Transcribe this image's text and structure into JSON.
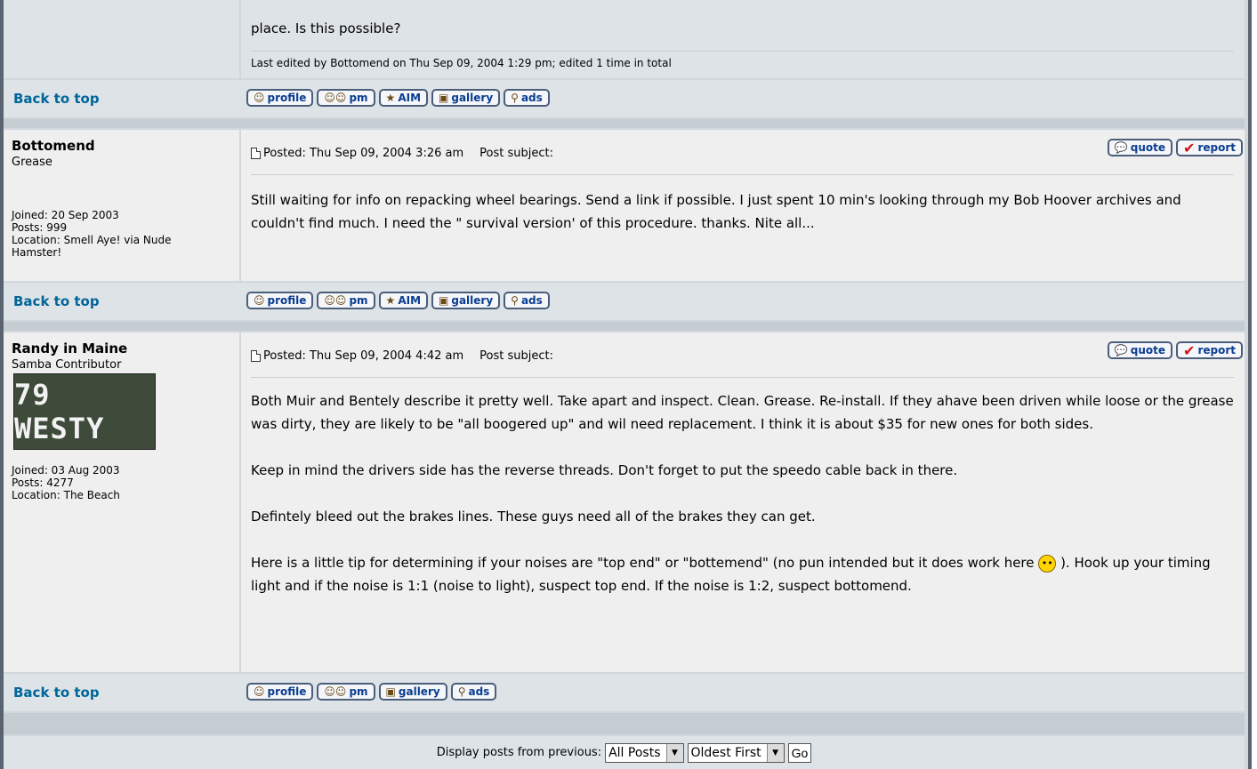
{
  "post0": {
    "body_tail": "place. Is this possible?",
    "edited": "Last edited by Bottomend on Thu Sep 09, 2004 1:29 pm; edited 1 time in total"
  },
  "back_to_top": "Back to top",
  "buttons": {
    "profile": "profile",
    "pm": "pm",
    "aim": "AIM",
    "gallery": "gallery",
    "ads": "ads",
    "quote": "quote",
    "report": "report"
  },
  "post1": {
    "username": "Bottomend",
    "rank": "Grease",
    "joined": "Joined: 20 Sep 2003",
    "posts": "Posts: 999",
    "location": "Location: Smell Aye! via Nude Hamster!",
    "posted": "Posted: Thu Sep 09, 2004 3:26 am",
    "subject": "Post subject:",
    "body": "Still waiting for info on repacking wheel bearings. Send a link if possible. I just spent 10 min's looking through my Bob Hoover archives and couldn't find much. I need the \" survival version' of this procedure. thanks. Nite all..."
  },
  "post2": {
    "username": "Randy in Maine",
    "rank": "Samba Contributor",
    "avatar_text": "79 WESTY",
    "joined": "Joined: 03 Aug 2003",
    "posts": "Posts: 4277",
    "location": "Location: The Beach",
    "posted": "Posted: Thu Sep 09, 2004 4:42 am",
    "subject": "Post subject:",
    "p1": "Both Muir and Bentely describe it pretty well. Take apart and inspect. Clean. Grease. Re-install. If they ahave been driven while loose or the grease was dirty, they are likely to be \"all boogered up\" and wil need replacement. I think it is about $35 for new ones for both sides.",
    "p2": "Keep in mind the drivers side has the reverse threads. Don't forget to put the speedo cable back in there.",
    "p3": "Defintely bleed out the brakes lines. These guys need all of the brakes they can get.",
    "p4a": "Here is a little tip for determining if your noises are \"top end\" or \"bottemend\" (no pun intended but it does work here",
    "p4b": "). Hook up your timing light and if the noise is 1:1 (noise to light), suspect top end. If the noise is 1:2, suspect bottomend."
  },
  "footer": {
    "label": "Display posts from previous:",
    "days_value": "All Posts",
    "order_value": "Oldest First",
    "go": "Go"
  }
}
